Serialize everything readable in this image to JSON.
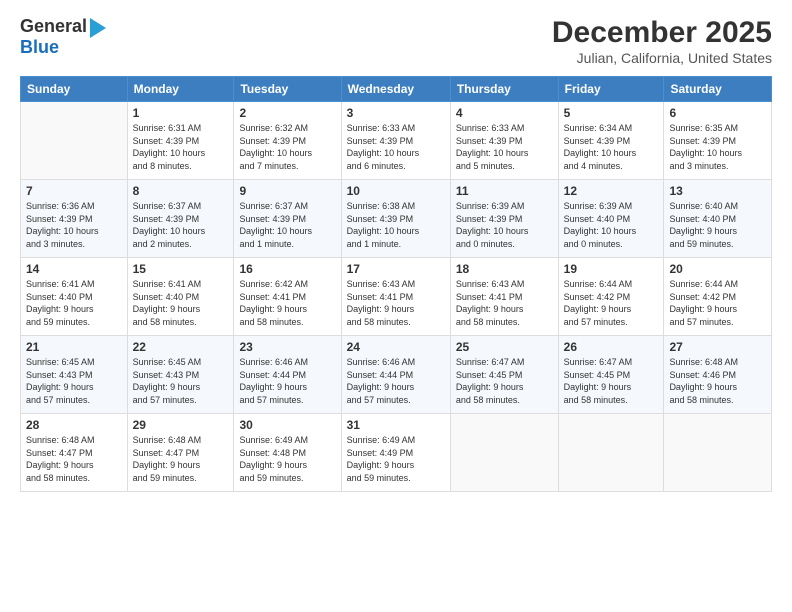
{
  "logo": {
    "line1": "General",
    "line2": "Blue"
  },
  "title": "December 2025",
  "subtitle": "Julian, California, United States",
  "days_header": [
    "Sunday",
    "Monday",
    "Tuesday",
    "Wednesday",
    "Thursday",
    "Friday",
    "Saturday"
  ],
  "weeks": [
    [
      {
        "day": "",
        "info": ""
      },
      {
        "day": "1",
        "info": "Sunrise: 6:31 AM\nSunset: 4:39 PM\nDaylight: 10 hours\nand 8 minutes."
      },
      {
        "day": "2",
        "info": "Sunrise: 6:32 AM\nSunset: 4:39 PM\nDaylight: 10 hours\nand 7 minutes."
      },
      {
        "day": "3",
        "info": "Sunrise: 6:33 AM\nSunset: 4:39 PM\nDaylight: 10 hours\nand 6 minutes."
      },
      {
        "day": "4",
        "info": "Sunrise: 6:33 AM\nSunset: 4:39 PM\nDaylight: 10 hours\nand 5 minutes."
      },
      {
        "day": "5",
        "info": "Sunrise: 6:34 AM\nSunset: 4:39 PM\nDaylight: 10 hours\nand 4 minutes."
      },
      {
        "day": "6",
        "info": "Sunrise: 6:35 AM\nSunset: 4:39 PM\nDaylight: 10 hours\nand 3 minutes."
      }
    ],
    [
      {
        "day": "7",
        "info": "Sunrise: 6:36 AM\nSunset: 4:39 PM\nDaylight: 10 hours\nand 3 minutes."
      },
      {
        "day": "8",
        "info": "Sunrise: 6:37 AM\nSunset: 4:39 PM\nDaylight: 10 hours\nand 2 minutes."
      },
      {
        "day": "9",
        "info": "Sunrise: 6:37 AM\nSunset: 4:39 PM\nDaylight: 10 hours\nand 1 minute."
      },
      {
        "day": "10",
        "info": "Sunrise: 6:38 AM\nSunset: 4:39 PM\nDaylight: 10 hours\nand 1 minute."
      },
      {
        "day": "11",
        "info": "Sunrise: 6:39 AM\nSunset: 4:39 PM\nDaylight: 10 hours\nand 0 minutes."
      },
      {
        "day": "12",
        "info": "Sunrise: 6:39 AM\nSunset: 4:40 PM\nDaylight: 10 hours\nand 0 minutes."
      },
      {
        "day": "13",
        "info": "Sunrise: 6:40 AM\nSunset: 4:40 PM\nDaylight: 9 hours\nand 59 minutes."
      }
    ],
    [
      {
        "day": "14",
        "info": "Sunrise: 6:41 AM\nSunset: 4:40 PM\nDaylight: 9 hours\nand 59 minutes."
      },
      {
        "day": "15",
        "info": "Sunrise: 6:41 AM\nSunset: 4:40 PM\nDaylight: 9 hours\nand 58 minutes."
      },
      {
        "day": "16",
        "info": "Sunrise: 6:42 AM\nSunset: 4:41 PM\nDaylight: 9 hours\nand 58 minutes."
      },
      {
        "day": "17",
        "info": "Sunrise: 6:43 AM\nSunset: 4:41 PM\nDaylight: 9 hours\nand 58 minutes."
      },
      {
        "day": "18",
        "info": "Sunrise: 6:43 AM\nSunset: 4:41 PM\nDaylight: 9 hours\nand 58 minutes."
      },
      {
        "day": "19",
        "info": "Sunrise: 6:44 AM\nSunset: 4:42 PM\nDaylight: 9 hours\nand 57 minutes."
      },
      {
        "day": "20",
        "info": "Sunrise: 6:44 AM\nSunset: 4:42 PM\nDaylight: 9 hours\nand 57 minutes."
      }
    ],
    [
      {
        "day": "21",
        "info": "Sunrise: 6:45 AM\nSunset: 4:43 PM\nDaylight: 9 hours\nand 57 minutes."
      },
      {
        "day": "22",
        "info": "Sunrise: 6:45 AM\nSunset: 4:43 PM\nDaylight: 9 hours\nand 57 minutes."
      },
      {
        "day": "23",
        "info": "Sunrise: 6:46 AM\nSunset: 4:44 PM\nDaylight: 9 hours\nand 57 minutes."
      },
      {
        "day": "24",
        "info": "Sunrise: 6:46 AM\nSunset: 4:44 PM\nDaylight: 9 hours\nand 57 minutes."
      },
      {
        "day": "25",
        "info": "Sunrise: 6:47 AM\nSunset: 4:45 PM\nDaylight: 9 hours\nand 58 minutes."
      },
      {
        "day": "26",
        "info": "Sunrise: 6:47 AM\nSunset: 4:45 PM\nDaylight: 9 hours\nand 58 minutes."
      },
      {
        "day": "27",
        "info": "Sunrise: 6:48 AM\nSunset: 4:46 PM\nDaylight: 9 hours\nand 58 minutes."
      }
    ],
    [
      {
        "day": "28",
        "info": "Sunrise: 6:48 AM\nSunset: 4:47 PM\nDaylight: 9 hours\nand 58 minutes."
      },
      {
        "day": "29",
        "info": "Sunrise: 6:48 AM\nSunset: 4:47 PM\nDaylight: 9 hours\nand 59 minutes."
      },
      {
        "day": "30",
        "info": "Sunrise: 6:49 AM\nSunset: 4:48 PM\nDaylight: 9 hours\nand 59 minutes."
      },
      {
        "day": "31",
        "info": "Sunrise: 6:49 AM\nSunset: 4:49 PM\nDaylight: 9 hours\nand 59 minutes."
      },
      {
        "day": "",
        "info": ""
      },
      {
        "day": "",
        "info": ""
      },
      {
        "day": "",
        "info": ""
      }
    ]
  ]
}
